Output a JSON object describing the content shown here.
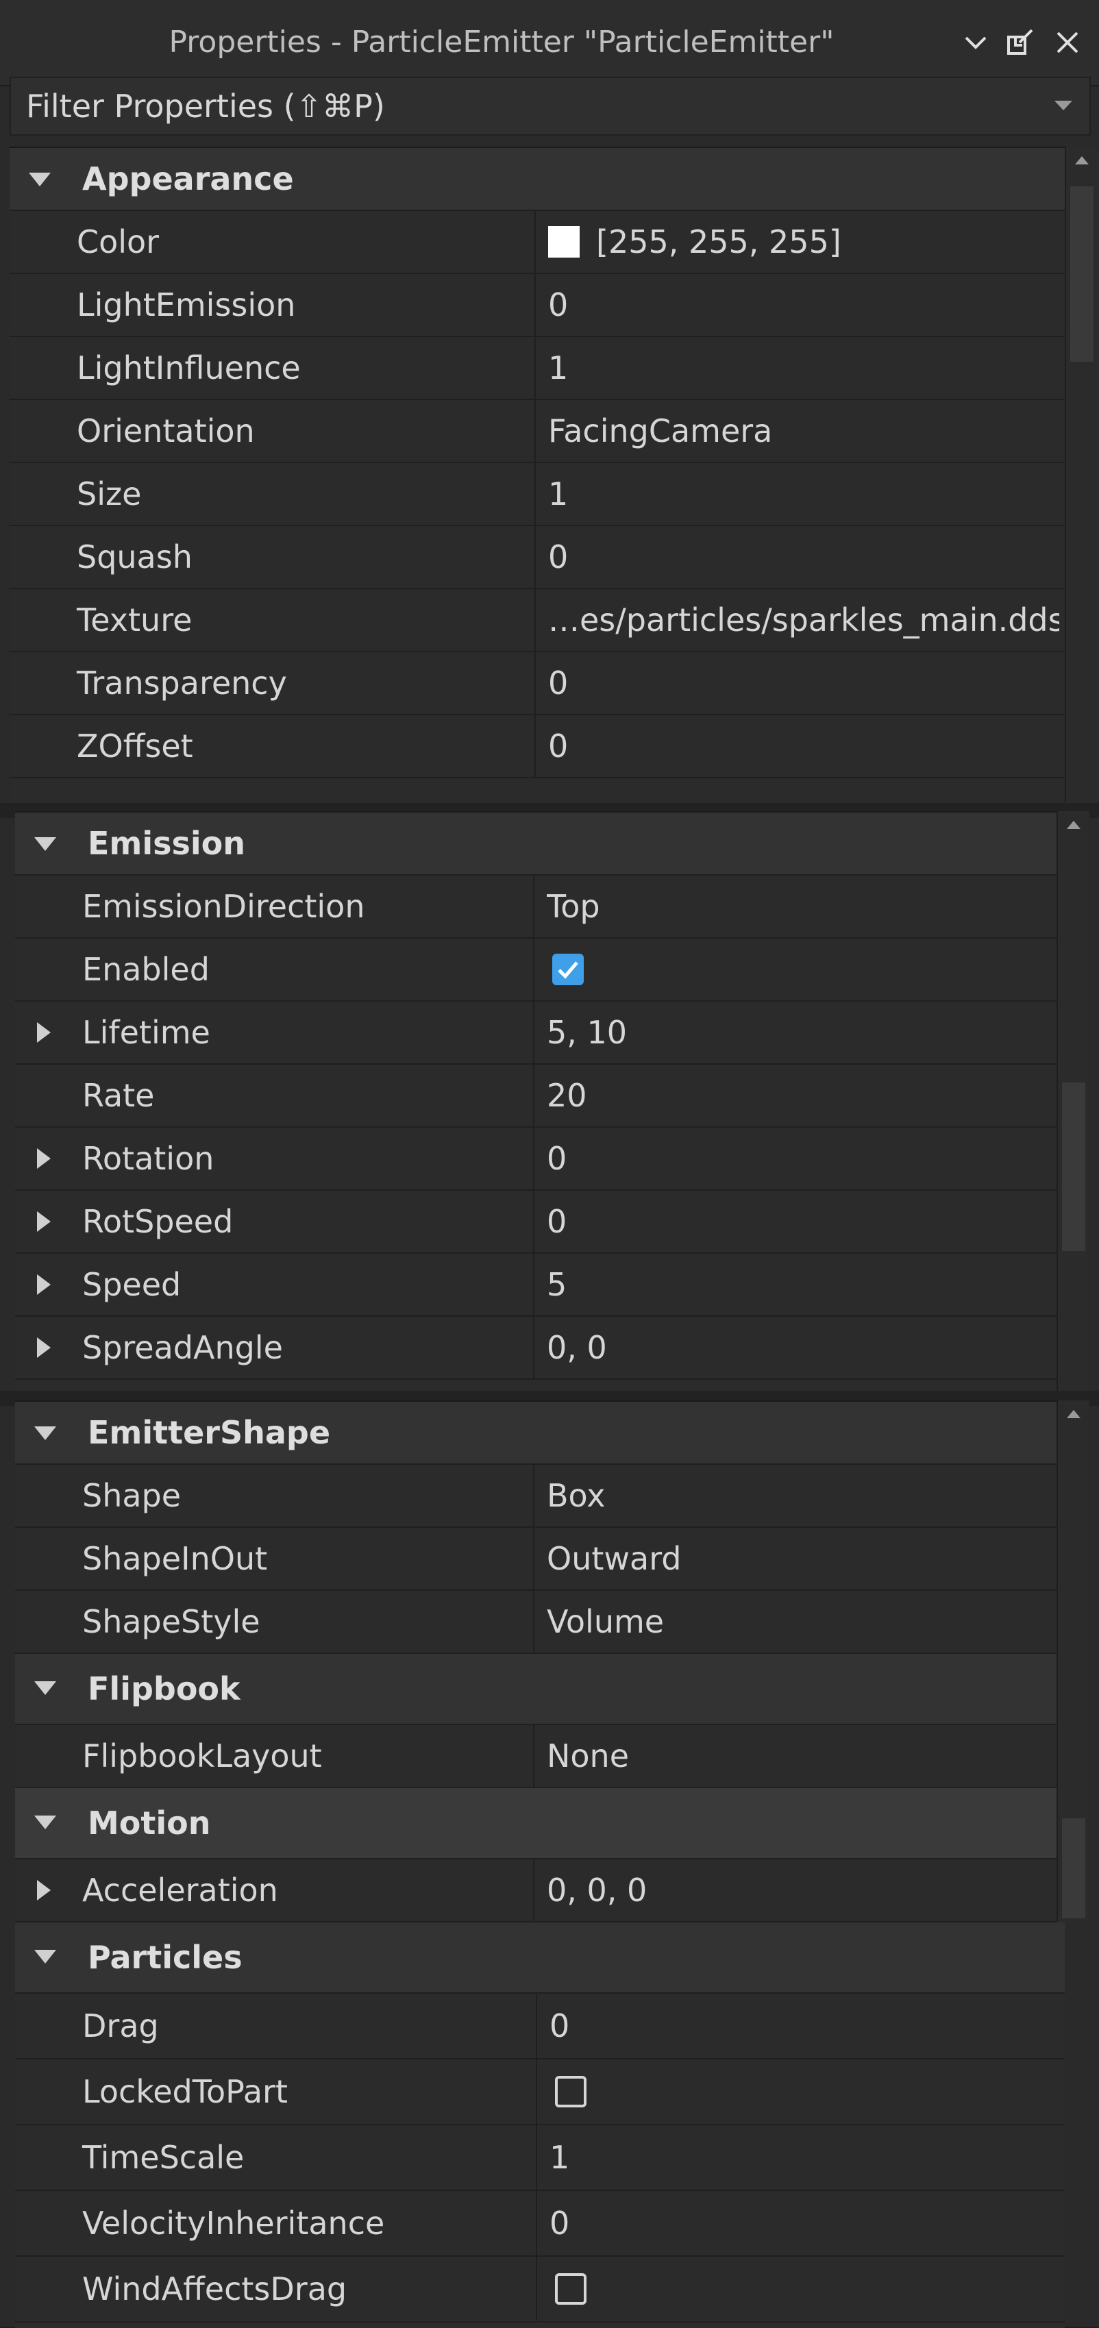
{
  "titlebar": {
    "title": "Properties - ParticleEmitter \"ParticleEmitter\"",
    "icons": [
      "chevron-down-icon",
      "undock-icon",
      "close-icon"
    ]
  },
  "filter": {
    "label": "Filter Properties (⇧⌘P)"
  },
  "appearance": {
    "title": "Appearance",
    "rows": [
      {
        "name": "Color",
        "value": "[255, 255, 255]"
      },
      {
        "name": "LightEmission",
        "value": "0"
      },
      {
        "name": "LightInfluence",
        "value": "1"
      },
      {
        "name": "Orientation",
        "value": "FacingCamera"
      },
      {
        "name": "Size",
        "value": "1"
      },
      {
        "name": "Squash",
        "value": "0"
      },
      {
        "name": "Texture",
        "value": "…es/particles/sparkles_main.dds"
      },
      {
        "name": "Transparency",
        "value": "0"
      },
      {
        "name": "ZOffset",
        "value": "0"
      }
    ]
  },
  "emission": {
    "title": "Emission",
    "rows": [
      {
        "name": "EmissionDirection",
        "value": "Top"
      },
      {
        "name": "Enabled",
        "checked": true
      },
      {
        "name": "Lifetime",
        "value": "5, 10",
        "expandable": true
      },
      {
        "name": "Rate",
        "value": "20"
      },
      {
        "name": "Rotation",
        "value": "0",
        "expandable": true
      },
      {
        "name": "RotSpeed",
        "value": "0",
        "expandable": true
      },
      {
        "name": "Speed",
        "value": "5",
        "expandable": true
      },
      {
        "name": "SpreadAngle",
        "value": "0, 0",
        "expandable": true
      }
    ]
  },
  "emitter_shape": {
    "title": "EmitterShape",
    "rows": [
      {
        "name": "Shape",
        "value": "Box"
      },
      {
        "name": "ShapeInOut",
        "value": "Outward"
      },
      {
        "name": "ShapeStyle",
        "value": "Volume"
      }
    ]
  },
  "flipbook": {
    "title": "Flipbook",
    "rows": [
      {
        "name": "FlipbookLayout",
        "value": "None"
      }
    ]
  },
  "motion": {
    "title": "Motion",
    "rows": [
      {
        "name": "Acceleration",
        "value": "0, 0, 0",
        "expandable": true
      }
    ]
  },
  "particles": {
    "title": "Particles",
    "rows": [
      {
        "name": "Drag",
        "value": "0"
      },
      {
        "name": "LockedToPart",
        "checked": false
      },
      {
        "name": "TimeScale",
        "value": "1"
      },
      {
        "name": "VelocityInheritance",
        "value": "0"
      },
      {
        "name": "WindAffectsDrag",
        "checked": false
      }
    ]
  },
  "colors": {
    "checkbox_on": "#3f9fe8",
    "panel_bg": "#2b2b2b",
    "group_bg": "#333333"
  }
}
